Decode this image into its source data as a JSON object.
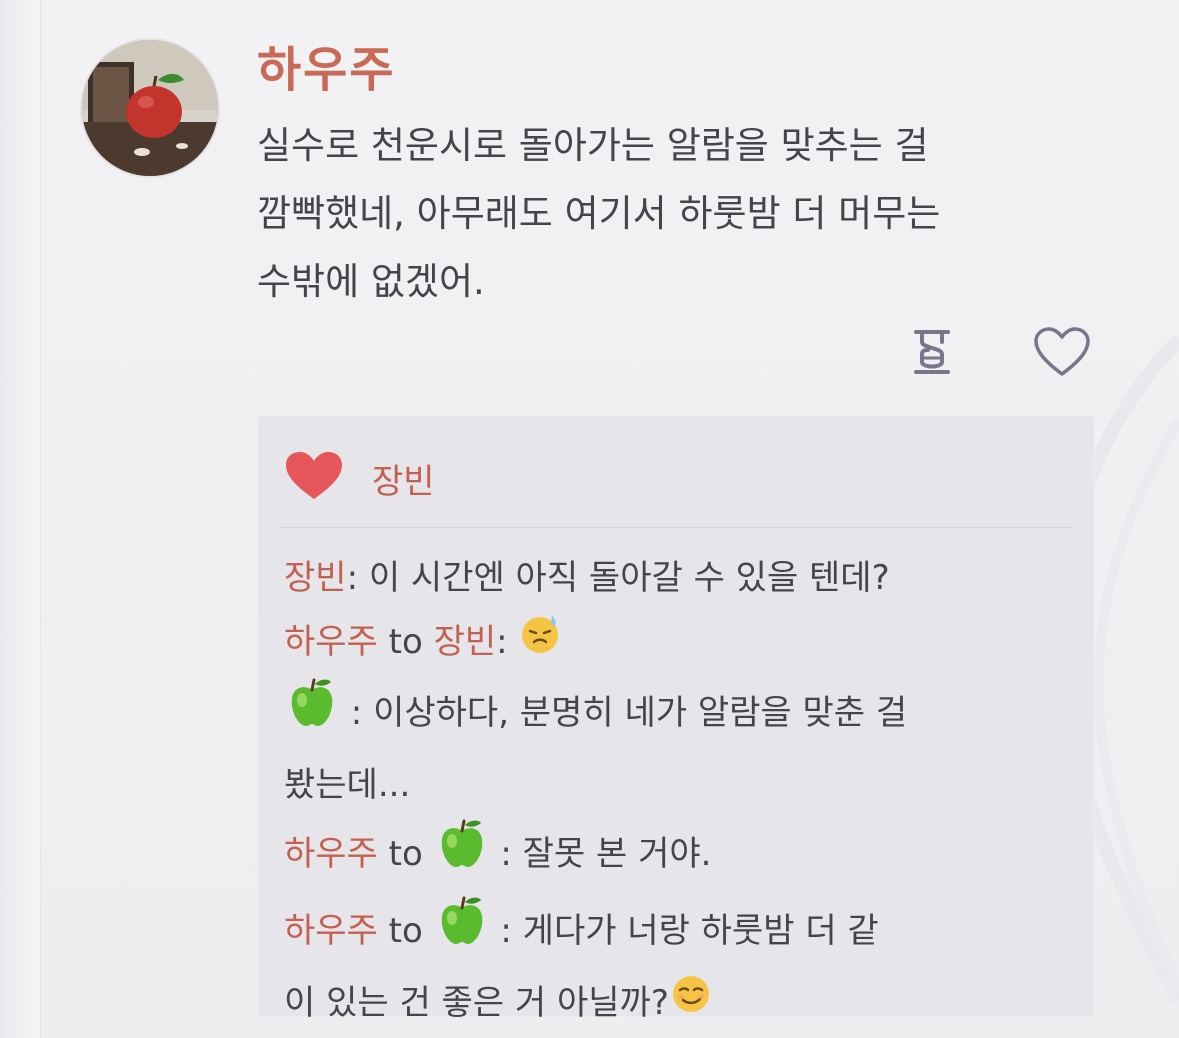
{
  "post": {
    "author": "하우주",
    "message_lines": [
      "실수로 천운시로 돌아가는 알람을 맞추는 걸",
      "깜빡했네, 아무래도 여기서 하룻밤 더 머무는",
      "수밖에 없겠어."
    ],
    "actions": {
      "hourglass_icon": "hourglass-icon",
      "like_icon": "heart-outline-icon"
    }
  },
  "likes": {
    "icon": "heart-filled-icon",
    "names": "장빈"
  },
  "comments": [
    {
      "name": "장빈",
      "text": ": 이 시간엔 아직 돌아갈 수 있을 텐데?"
    },
    {
      "name": "하우주",
      "to": " to ",
      "target": "장빈",
      "sep": ": ",
      "emoji": "sweat-smile-emoji"
    },
    {
      "apple": "green-apple-emoji",
      "text": " : 이상하다, 분명히 네가 알람을 맞춘 걸",
      "text2": "봤는데..."
    },
    {
      "name": "하우주",
      "to": " to ",
      "apple": "green-apple-emoji",
      "text": " : 잘못 본 거야."
    },
    {
      "name": "하우주",
      "to": " to ",
      "apple": "green-apple-emoji",
      "text": " : 게다가 너랑 하룻밤 더 같",
      "text2": "이 있는 건 좋은 거 아닐까?",
      "emoji": "smirk-emoji"
    }
  ],
  "colors": {
    "accent_name": "#c86a55",
    "like_heart": "#e5575a",
    "body_text": "#44444a",
    "icon_stroke": "#77768a"
  }
}
